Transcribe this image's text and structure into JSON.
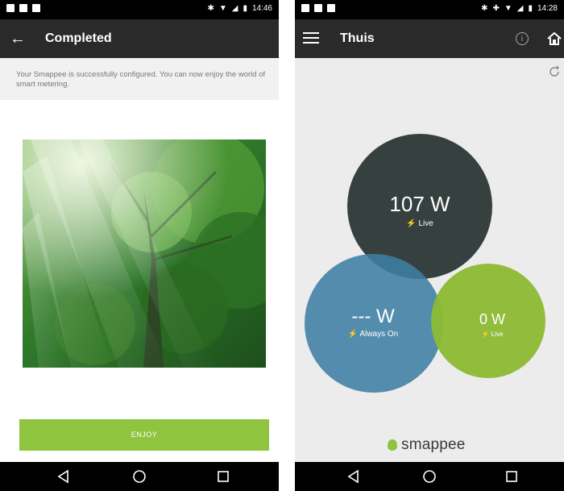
{
  "left_screen": {
    "status_time": "14:46",
    "title": "Completed",
    "message": "Your Smappee is successfully configured. You can now enjoy the world of smart metering.",
    "enjoy_button": "ENJOY"
  },
  "right_screen": {
    "status_time": "14:28",
    "title": "Thuis",
    "circles": {
      "total": {
        "value": "107 W",
        "label": "Live"
      },
      "always_on": {
        "value": "--- W",
        "label": "Always On"
      },
      "solar": {
        "value": "0 W",
        "label": "Live"
      }
    },
    "brand": "smappee"
  },
  "colors": {
    "accent_green": "#8ec43e",
    "circle_dark": "#36413f",
    "circle_blue": "#3d7ea3",
    "circle_green": "#8dbb33",
    "appbar": "#2a2a2a"
  }
}
